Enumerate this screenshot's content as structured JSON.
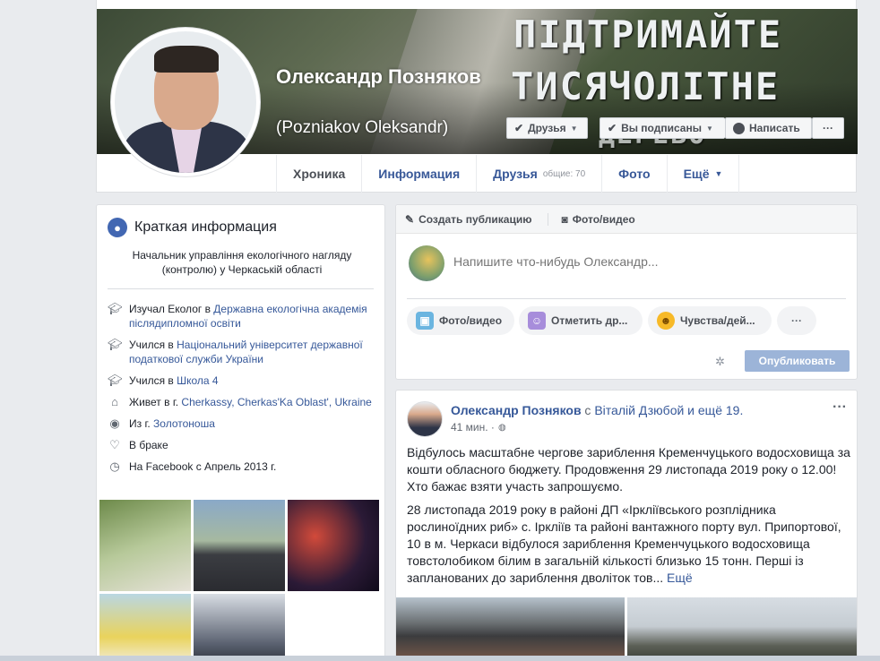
{
  "cover": {
    "line1": "ПІДТРИМАЙТЕ",
    "line2": "ТИСЯЧОЛІТНЕ",
    "line3": "ДЕРЕВО"
  },
  "profile": {
    "name": "Олександр Позняков",
    "alt_name": "(Pozniakov Oleksandr)"
  },
  "actions": {
    "friends": "Друзья",
    "subscribed": "Вы подписаны",
    "message": "Написать",
    "more": "···"
  },
  "tabs": [
    {
      "label": "Хроника"
    },
    {
      "label": "Информация"
    },
    {
      "label": "Друзья",
      "sub": "общие: 70"
    },
    {
      "label": "Фото"
    },
    {
      "label": "Ещё"
    }
  ],
  "intro": {
    "title": "Краткая информация",
    "bio": "Начальник управління екологічного нагляду (контролю) у Черкаській області",
    "items": [
      {
        "prefix": "Изучал Еколог в ",
        "link": "Державна екологічна академія післядипломної освіти",
        "icon": "graduation-cap-icon"
      },
      {
        "prefix": "Учился в ",
        "link": "Національний університет державної податкової служби України",
        "icon": "graduation-cap-icon"
      },
      {
        "prefix": "Учился в ",
        "link": "Школа 4",
        "icon": "graduation-cap-icon"
      },
      {
        "prefix": "Живет в г. ",
        "link": "Cherkassy, Cherkas'Ka Oblast', Ukraine",
        "icon": "home-icon"
      },
      {
        "prefix": "Из г. ",
        "link": "Золотоноша",
        "icon": "location-pin-icon"
      },
      {
        "prefix": "В браке",
        "link": "",
        "icon": "heart-icon"
      },
      {
        "prefix": "На Facebook с Апрель 2013 г.",
        "link": "",
        "icon": "clock-icon"
      }
    ]
  },
  "composer": {
    "tab_create": "Создать публикацию",
    "tab_photo": "Фото/видео",
    "placeholder": "Напишите что-нибудь Олександр...",
    "pill_photo": "Фото/видео",
    "pill_tag": "Отметить др...",
    "pill_feeling": "Чувства/дей...",
    "pill_more": "···",
    "publish": "Опубликовать"
  },
  "post": {
    "author": "Олександр Позняков",
    "with_text": " с ",
    "with_link": "Віталій Дзюбой и ещё 19.",
    "time": "41 мин. ·",
    "paragraph1": "Відбулось масштабне чергове зариблення Кременчуцького водосховища за кошти обласного бюджету. Продовження 29 листопада 2019 року о 12.00! Хто бажає взяти участь запрошуємо.",
    "paragraph2": "28 листопада 2019 року в районі ДП «Ірклiївського розплідника рослиноїдних риб» с. Ірклiїв та районі вантажного порту вул. Припортової, 10 в м. Черкаси вiдбулося зариблення Кременчуцького водосховища товстолобиком білим в загальній кількості близько 15 тонн. Перші із запланованих до зариблення дволiток тов...",
    "more": "Ещё"
  }
}
